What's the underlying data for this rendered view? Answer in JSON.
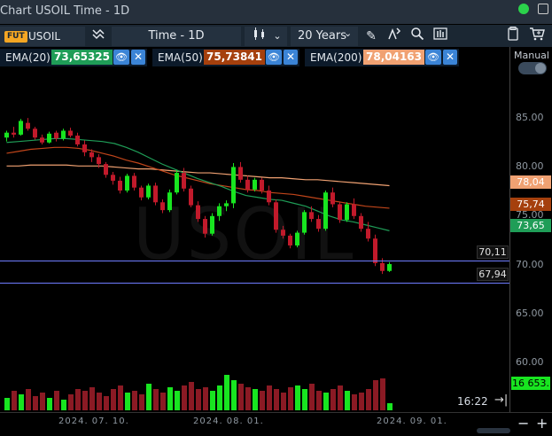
{
  "window": {
    "title": "Chart USOIL Time - 1D"
  },
  "toolbar": {
    "badge": "FUT",
    "symbol": "USOIL",
    "timeframe": "Time - 1D",
    "range": "20 Years"
  },
  "indicators": [
    {
      "label": "EMA(20)",
      "value": "73,65325",
      "color": "#1f9d57"
    },
    {
      "label": "EMA(50)",
      "value": "75,73841",
      "color": "#a5400d"
    },
    {
      "label": "EMA(200)",
      "value": "78,04163",
      "color": "#f0a172"
    }
  ],
  "axis": {
    "mode_label": "Manual",
    "ticks": [
      "85.00",
      "80.00",
      "75.00",
      "70.00",
      "65.00",
      "60.00"
    ],
    "tags": [
      {
        "text": "78,04",
        "color": "#f0a172"
      },
      {
        "text": "75,74",
        "color": "#a5400d"
      },
      {
        "text": "73,65",
        "color": "#1f9d57"
      }
    ]
  },
  "watermark": "USOIL",
  "price_lines": [
    "70,11",
    "67,94"
  ],
  "volume_tag": "16 653.",
  "footer": {
    "time": "16:22",
    "dates": [
      "2024. 07. 10.",
      "2024. 08. 01.",
      "2024. 09. 01."
    ],
    "zoom_out": "−",
    "zoom_in": "+"
  },
  "chart_data": {
    "type": "candlestick",
    "ylim": [
      57,
      90
    ],
    "candles": [
      [
        82.9,
        83.6,
        82.5,
        83.4
      ],
      [
        83.4,
        84.0,
        82.9,
        83.2
      ],
      [
        83.2,
        84.8,
        83.1,
        84.6
      ],
      [
        84.4,
        84.9,
        83.6,
        83.8
      ],
      [
        83.8,
        84.0,
        82.7,
        82.9
      ],
      [
        82.9,
        83.2,
        82.2,
        82.4
      ],
      [
        82.4,
        83.5,
        82.3,
        83.3
      ],
      [
        83.4,
        83.6,
        82.5,
        82.8
      ],
      [
        82.8,
        83.8,
        82.6,
        83.6
      ],
      [
        83.6,
        83.9,
        82.9,
        83.1
      ],
      [
        83.1,
        83.4,
        82.0,
        82.2
      ],
      [
        82.2,
        82.6,
        81.0,
        81.4
      ],
      [
        81.4,
        81.7,
        80.4,
        80.9
      ],
      [
        80.9,
        81.2,
        79.8,
        80.2
      ],
      [
        80.2,
        80.4,
        78.8,
        79.1
      ],
      [
        79.1,
        79.4,
        78.1,
        78.5
      ],
      [
        78.5,
        78.9,
        77.2,
        77.5
      ],
      [
        77.5,
        79.2,
        77.3,
        79.0
      ],
      [
        79.0,
        79.3,
        77.5,
        77.8
      ],
      [
        77.8,
        78.0,
        76.5,
        76.8
      ],
      [
        76.8,
        78.2,
        76.6,
        78.0
      ],
      [
        78.0,
        78.3,
        76.0,
        76.3
      ],
      [
        76.3,
        76.6,
        75.2,
        75.5
      ],
      [
        75.5,
        77.6,
        75.3,
        77.3
      ],
      [
        77.3,
        79.6,
        77.1,
        79.3
      ],
      [
        79.3,
        79.8,
        77.4,
        77.7
      ],
      [
        77.7,
        78.0,
        75.8,
        76.0
      ],
      [
        76.0,
        76.4,
        74.3,
        74.6
      ],
      [
        74.6,
        74.9,
        72.7,
        73.1
      ],
      [
        73.1,
        75.2,
        72.9,
        74.9
      ],
      [
        74.9,
        76.2,
        74.4,
        75.9
      ],
      [
        75.9,
        76.5,
        75.4,
        76.2
      ],
      [
        76.2,
        80.3,
        75.7,
        79.9
      ],
      [
        79.9,
        80.4,
        78.3,
        78.6
      ],
      [
        78.6,
        79.0,
        77.3,
        77.6
      ],
      [
        77.6,
        78.8,
        77.4,
        78.6
      ],
      [
        78.6,
        78.8,
        77.2,
        77.5
      ],
      [
        77.5,
        78.0,
        76.0,
        76.3
      ],
      [
        76.3,
        76.6,
        73.2,
        73.5
      ],
      [
        73.5,
        73.9,
        72.6,
        72.9
      ],
      [
        72.9,
        73.1,
        71.6,
        71.9
      ],
      [
        71.9,
        73.4,
        71.7,
        73.2
      ],
      [
        73.2,
        75.5,
        73.0,
        75.3
      ],
      [
        75.3,
        75.9,
        74.3,
        74.6
      ],
      [
        74.6,
        75.0,
        73.3,
        73.6
      ],
      [
        73.6,
        77.5,
        73.4,
        77.3
      ],
      [
        77.3,
        77.8,
        75.8,
        76.1
      ],
      [
        76.1,
        76.3,
        74.2,
        74.5
      ],
      [
        74.5,
        76.3,
        74.3,
        76.1
      ],
      [
        76.1,
        76.7,
        74.6,
        74.9
      ],
      [
        74.9,
        75.2,
        73.3,
        73.6
      ],
      [
        73.6,
        74.3,
        72.3,
        72.6
      ],
      [
        72.6,
        73.0,
        69.8,
        70.1
      ],
      [
        70.1,
        70.6,
        69.0,
        69.3
      ],
      [
        69.3,
        70.2,
        69.2,
        70.0
      ]
    ],
    "ema20": [
      82.4,
      82.5,
      82.6,
      82.7,
      82.8,
      82.8,
      82.7,
      82.6,
      82.5,
      82.3,
      81.9,
      81.4,
      80.8,
      80.2,
      79.7,
      79.2,
      78.7,
      78.3,
      77.9,
      77.4,
      77.0,
      76.8,
      76.6,
      76.5,
      76.2,
      75.9,
      75.4,
      74.9,
      74.5,
      74.3,
      74.0,
      73.7,
      73.4
    ],
    "ema50": [
      81.3,
      81.5,
      81.7,
      81.8,
      81.9,
      81.9,
      81.8,
      81.6,
      81.3,
      81.0,
      80.6,
      80.3,
      79.9,
      79.5,
      79.1,
      78.8,
      78.5,
      78.2,
      78.0,
      77.8,
      77.6,
      77.5,
      77.3,
      77.2,
      77.1,
      76.9,
      76.7,
      76.5,
      76.3,
      76.1,
      75.9,
      75.8,
      75.7
    ],
    "ema200": [
      80.0,
      80.0,
      80.1,
      80.1,
      80.1,
      80.1,
      80.0,
      80.0,
      80.0,
      79.9,
      79.8,
      79.7,
      79.7,
      79.6,
      79.5,
      79.4,
      79.3,
      79.3,
      79.2,
      79.1,
      79.0,
      78.9,
      78.8,
      78.8,
      78.7,
      78.6,
      78.6,
      78.5,
      78.4,
      78.3,
      78.2,
      78.1,
      78.0
    ],
    "volume": [
      0.35,
      0.55,
      0.45,
      0.6,
      0.4,
      0.5,
      0.35,
      0.55,
      0.3,
      0.45,
      0.6,
      0.55,
      0.65,
      0.5,
      0.4,
      0.6,
      0.7,
      0.5,
      0.55,
      0.45,
      0.75,
      0.6,
      0.5,
      0.65,
      0.55,
      0.7,
      0.8,
      0.6,
      0.65,
      0.55,
      0.7,
      1.0,
      0.85,
      0.75,
      0.65,
      0.6,
      0.55,
      0.7,
      0.6,
      0.5,
      0.65,
      0.7,
      0.6,
      0.75,
      0.55,
      0.5,
      0.6,
      0.7,
      0.55,
      0.45,
      0.5,
      0.6,
      0.85,
      0.9,
      0.2
    ]
  }
}
